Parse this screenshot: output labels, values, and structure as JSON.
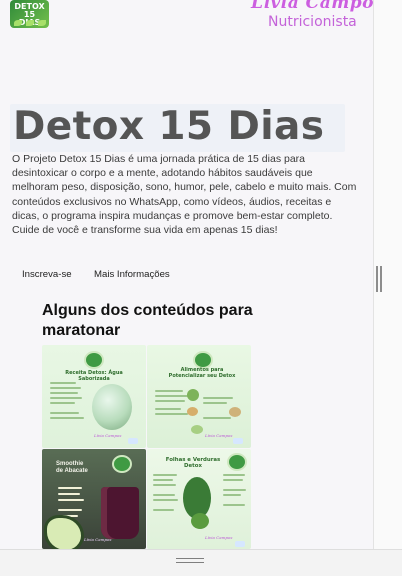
{
  "logo": {
    "text": "DETOX 15 DIAS"
  },
  "brand": {
    "name": "Lívia Campos",
    "role": "Nutricionista"
  },
  "hero": {
    "title": "Detox 15 Dias",
    "description": "O Projeto Detox 15 Dias é uma jornada prática de 15 dias para desintoxicar o corpo e a mente, adotando hábitos saudáveis que melhoram peso, disposição, sono, humor, pele, cabelo e muito mais. Com conteúdos exclusivos no WhatsApp, como vídeos, áudios, receitas e dicas, o programa inspira mudanças e promove bem-estar completo. Cuide de você e transforme sua vida em apenas 15 dias!"
  },
  "actions": {
    "subscribe": "Inscreva-se",
    "more_info": "Mais Informações"
  },
  "section": {
    "title": "Alguns dos conteúdos para maratonar"
  },
  "cards": [
    {
      "title": "Receita Detox: Água Saborizada"
    },
    {
      "title": "Alimentos para Potencializar seu Detox"
    },
    {
      "title": "Smoothie de Abacate"
    },
    {
      "title": "Folhas e Verduras Detox"
    }
  ],
  "colors": {
    "brand_purple": "#c463d9",
    "title_gray": "#555555",
    "green": "#3f9a43"
  }
}
